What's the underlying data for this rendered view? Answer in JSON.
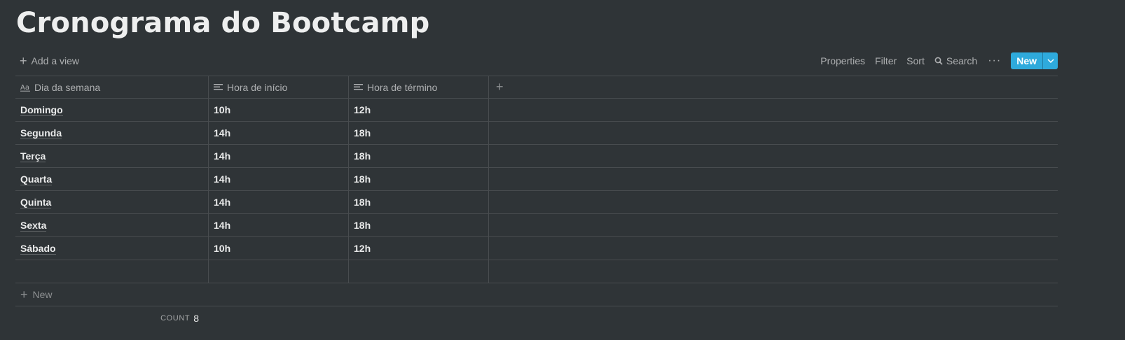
{
  "page": {
    "title": "Cronograma do Bootcamp"
  },
  "toolbar": {
    "add_view": "Add a view",
    "properties": "Properties",
    "filter": "Filter",
    "sort": "Sort",
    "search": "Search",
    "more": "···",
    "new": "New"
  },
  "table": {
    "columns": [
      {
        "label": "Dia da semana",
        "icon": "title-aa-icon"
      },
      {
        "label": "Hora de início",
        "icon": "text-lines-icon"
      },
      {
        "label": "Hora de término",
        "icon": "text-lines-icon"
      }
    ],
    "rows": [
      {
        "day": "Domingo",
        "start": "10h",
        "end": "12h"
      },
      {
        "day": "Segunda",
        "start": "14h",
        "end": "18h"
      },
      {
        "day": "Terça",
        "start": "14h",
        "end": "18h"
      },
      {
        "day": "Quarta",
        "start": "14h",
        "end": "18h"
      },
      {
        "day": "Quinta",
        "start": "14h",
        "end": "18h"
      },
      {
        "day": "Sexta",
        "start": "14h",
        "end": "18h"
      },
      {
        "day": "Sábado",
        "start": "10h",
        "end": "12h"
      }
    ],
    "new_row_label": "New",
    "count_label": "COUNT",
    "count_value": "8"
  },
  "colors": {
    "background": "#2f3437",
    "accent": "#2eaadc"
  }
}
